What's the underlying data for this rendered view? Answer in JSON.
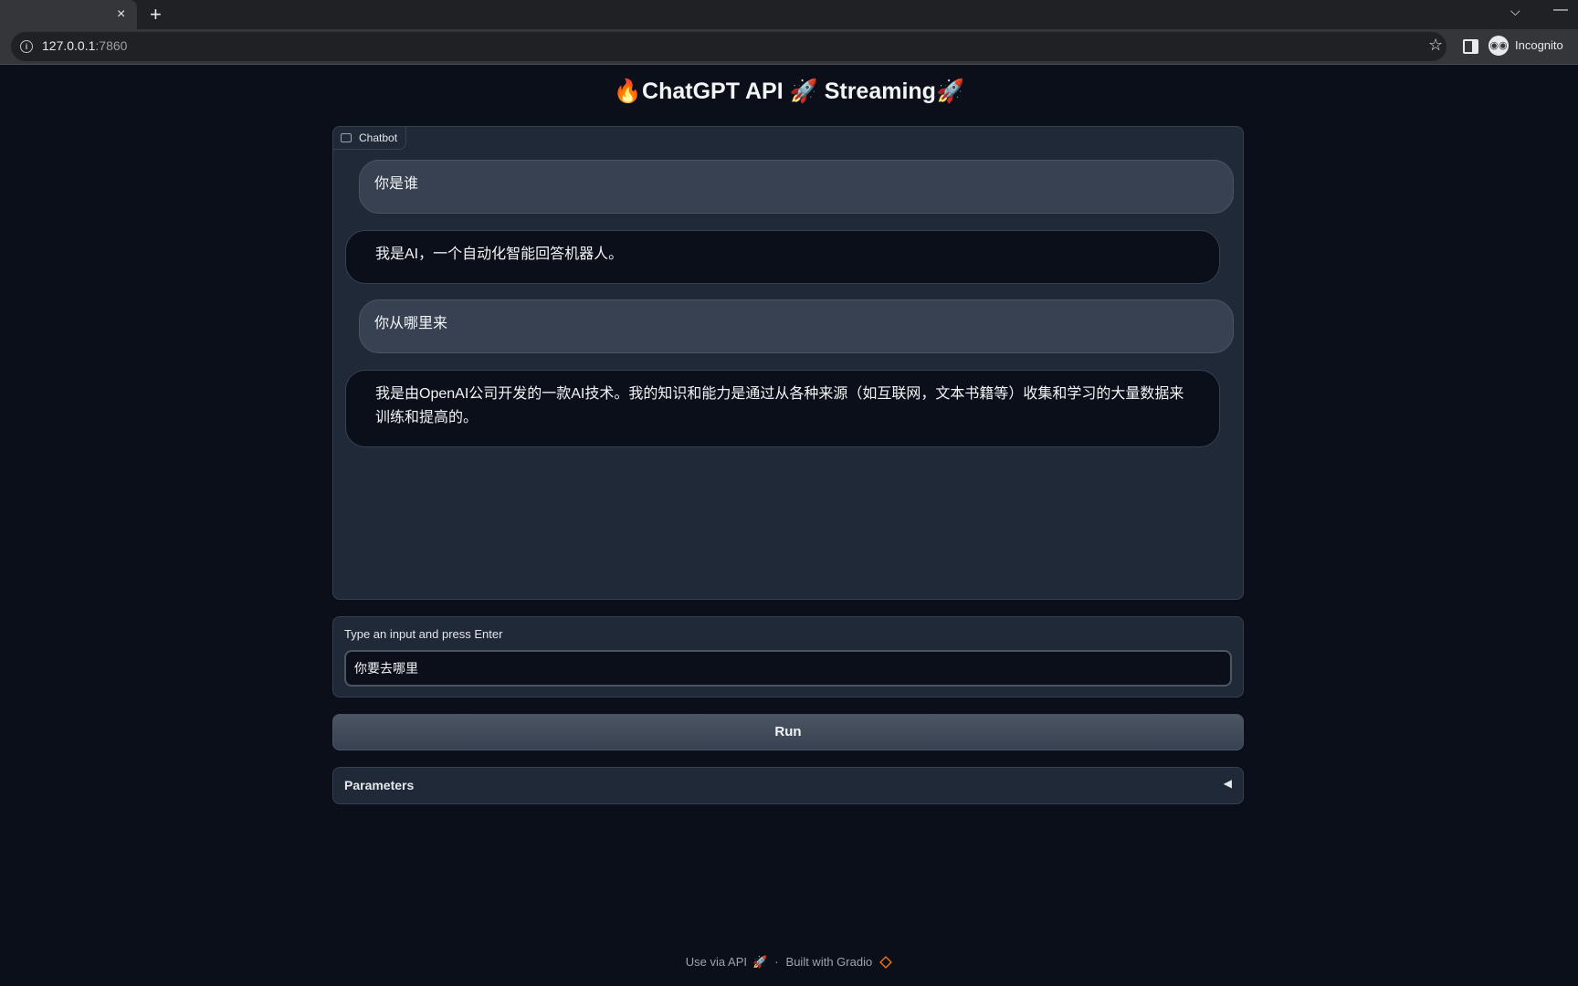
{
  "browser": {
    "tab_close": "×",
    "new_tab": "+",
    "tab_menu": "⌵",
    "minimize": "—",
    "url_host": "127.0.0.1",
    "url_port": ":7860",
    "info_icon": "i",
    "star_icon": "☆",
    "incognito_label": "Incognito"
  },
  "app": {
    "title": "🔥ChatGPT API 🚀 Streaming🚀",
    "chatbot_label": "Chatbot",
    "messages": [
      {
        "role": "user",
        "text": "你是谁"
      },
      {
        "role": "bot",
        "text": "我是AI，一个自动化智能回答机器人。"
      },
      {
        "role": "user",
        "text": "你从哪里来"
      },
      {
        "role": "bot",
        "text": "我是由OpenAI公司开发的一款AI技术。我的知识和能力是通过从各种来源（如互联网，文本书籍等）收集和学习的大量数据来训练和提高的。"
      }
    ],
    "input_label": "Type an input and press Enter",
    "input_value": "你要去哪里",
    "run_label": "Run",
    "params_label": "Parameters",
    "params_arrow": "◀"
  },
  "footer": {
    "use_api": "Use via API",
    "rocket": "🚀",
    "dot": "·",
    "built_with": "Built with Gradio"
  }
}
